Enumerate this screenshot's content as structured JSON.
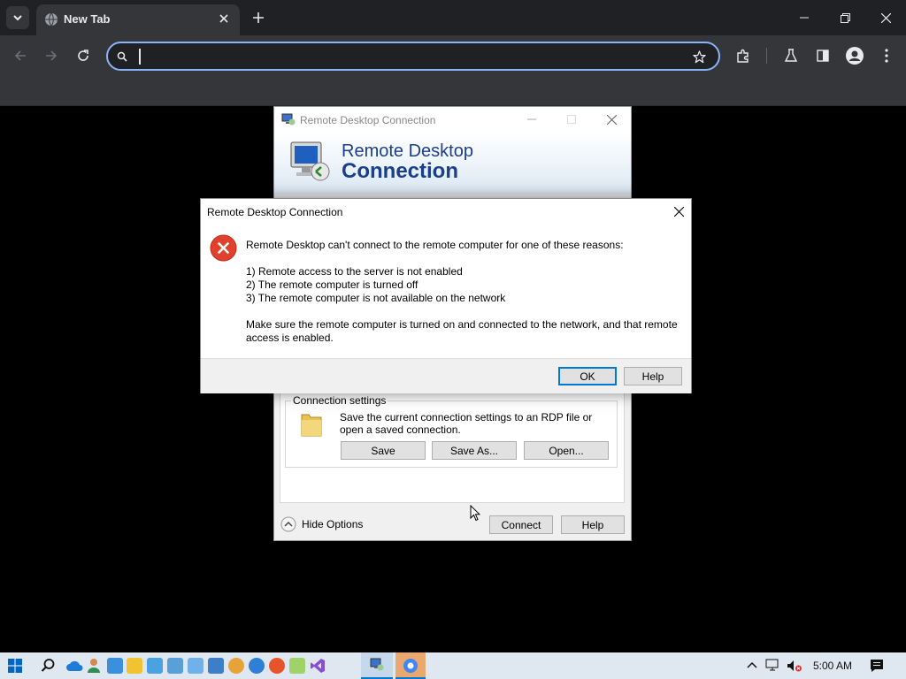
{
  "browser": {
    "tab_title": "New Tab",
    "omnibox_value": "",
    "icons": [
      "tab-search-icon",
      "close-icon",
      "new-tab-icon",
      "minimize-icon",
      "restore-icon",
      "window-close-icon",
      "back-icon",
      "forward-icon",
      "reload-icon",
      "search-icon",
      "star-icon",
      "extensions-icon",
      "labs-icon",
      "side-panel-icon",
      "profile-icon",
      "menu-icon"
    ]
  },
  "rdc_window": {
    "title": "Remote Desktop Connection",
    "banner_line1": "Remote Desktop",
    "banner_line2": "Connection",
    "connection_settings_label": "Connection settings",
    "connection_settings_desc": "Save the current connection settings to an RDP file or open a saved connection.",
    "save_label": "Save",
    "save_as_label": "Save As...",
    "open_label": "Open...",
    "hide_options_label": "Hide Options",
    "connect_label": "Connect",
    "help_label": "Help"
  },
  "error_dialog": {
    "title": "Remote Desktop Connection",
    "message_intro": "Remote Desktop can't connect to the remote computer for one of these reasons:",
    "reasons": [
      "1) Remote access to the server is not enabled",
      "2) The remote computer is turned off",
      "3) The remote computer is not available on the network"
    ],
    "advice": "Make sure the remote computer is turned on and connected to the network, and that remote access is enabled.",
    "ok_label": "OK",
    "help_label": "Help"
  },
  "taskbar": {
    "clock": "5:00 AM",
    "colors": {
      "accent": "#0078d4",
      "error_red": "#e0412c",
      "banner_blue": "#003399"
    }
  }
}
